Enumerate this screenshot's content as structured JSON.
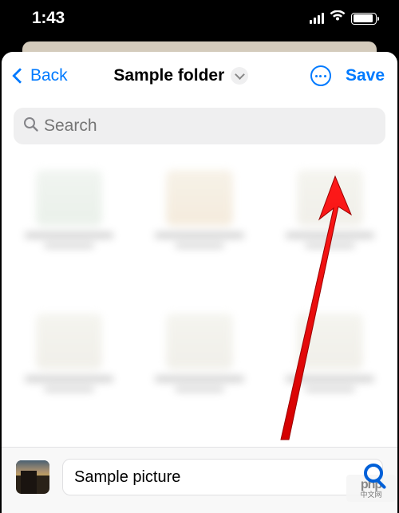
{
  "status": {
    "time": "1:43"
  },
  "nav": {
    "back_label": "Back",
    "title": "Sample folder",
    "save_label": "Save"
  },
  "search": {
    "placeholder": "Search"
  },
  "footer": {
    "filename": "Sample picture"
  },
  "watermark": {
    "line1": "php",
    "line2": "中文网"
  }
}
